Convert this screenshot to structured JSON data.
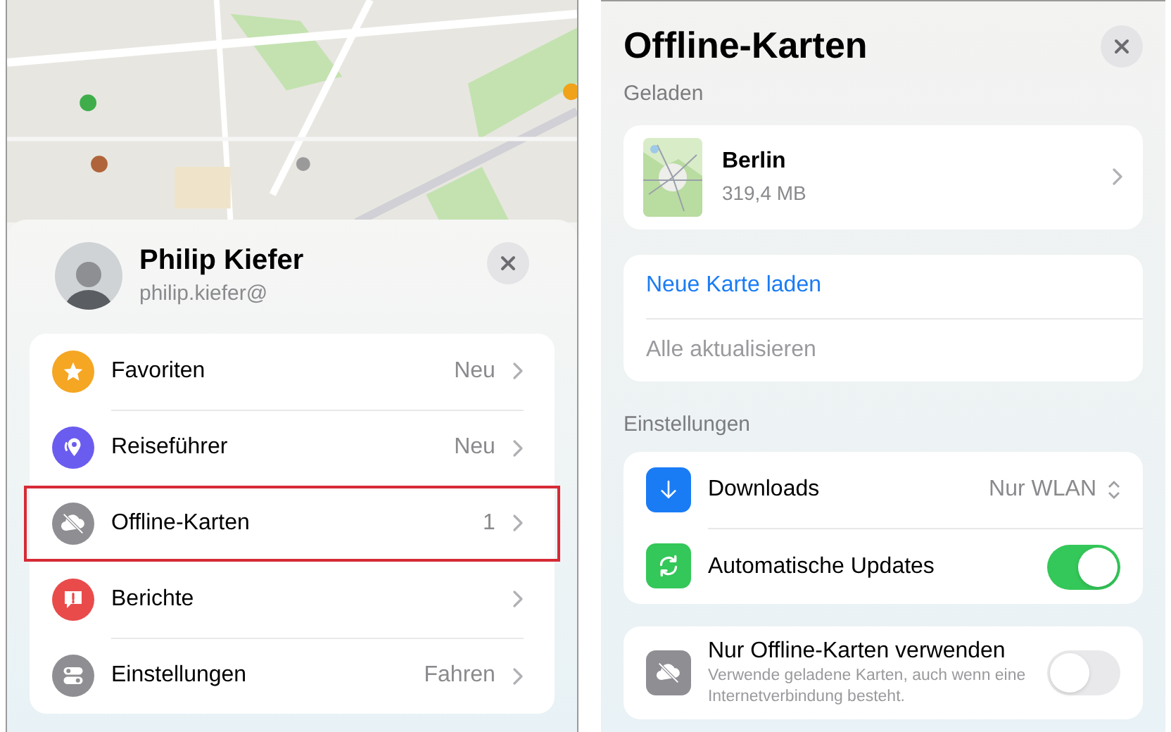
{
  "left": {
    "profile": {
      "name": "Philip Kiefer",
      "email": "philip.kiefer@"
    },
    "menu": [
      {
        "label": "Favoriten",
        "value": "Neu",
        "color": "#f5a623",
        "highlighted": false
      },
      {
        "label": "Reiseführer",
        "value": "Neu",
        "color": "#6b5cf0",
        "highlighted": false
      },
      {
        "label": "Offline-Karten",
        "value": "1",
        "color": "#8e8e93",
        "highlighted": true
      },
      {
        "label": "Berichte",
        "color": "#e94b4b",
        "highlighted": false
      },
      {
        "label": "Einstellungen",
        "value": "Fahren",
        "color": "#8e8e93",
        "highlighted": false
      }
    ]
  },
  "right": {
    "title": "Offline-Karten",
    "loaded_header": "Geladen",
    "maps": [
      {
        "name": "Berlin",
        "size": "319,4 MB"
      }
    ],
    "actions": [
      {
        "label": "Neue Karte laden",
        "disabled": false
      },
      {
        "label": "Alle aktualisieren",
        "disabled": true
      }
    ],
    "settings_header": "Einstellungen",
    "settings": [
      {
        "kind": "select",
        "label": "Downloads",
        "value": "Nur WLAN",
        "color": "#1a7cf5"
      },
      {
        "kind": "toggle",
        "label": "Automatische Updates",
        "on": true,
        "color": "#34c759"
      }
    ],
    "offline_only": {
      "label": "Nur Offline-Karten verwenden",
      "description": "Verwende geladene Karten, auch wenn eine Internetverbindung besteht.",
      "on": false
    }
  }
}
